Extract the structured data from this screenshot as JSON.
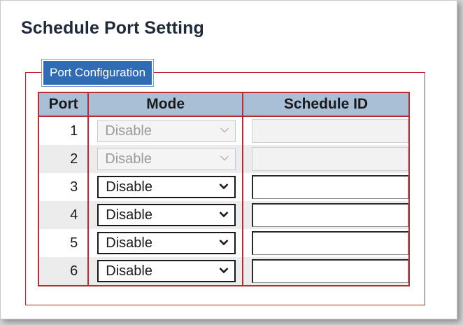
{
  "page": {
    "title": "Schedule Port Setting"
  },
  "section": {
    "legend": "Port Configuration"
  },
  "table": {
    "headers": {
      "port": "Port",
      "mode": "Mode",
      "schedule_id": "Schedule ID"
    },
    "rows": [
      {
        "port": "1",
        "mode": "Disable",
        "schedule_id": "",
        "enabled": false
      },
      {
        "port": "2",
        "mode": "Disable",
        "schedule_id": "",
        "enabled": false
      },
      {
        "port": "3",
        "mode": "Disable",
        "schedule_id": "",
        "enabled": true
      },
      {
        "port": "4",
        "mode": "Disable",
        "schedule_id": "",
        "enabled": true
      },
      {
        "port": "5",
        "mode": "Disable",
        "schedule_id": "",
        "enabled": true
      },
      {
        "port": "6",
        "mode": "Disable",
        "schedule_id": "",
        "enabled": true
      }
    ]
  },
  "icons": {
    "dropdown": "chevron-down-icon"
  },
  "colors": {
    "legend_bg": "#2f6cb5",
    "frame_border": "#c0242d",
    "header_bg": "#a9bfd6"
  }
}
